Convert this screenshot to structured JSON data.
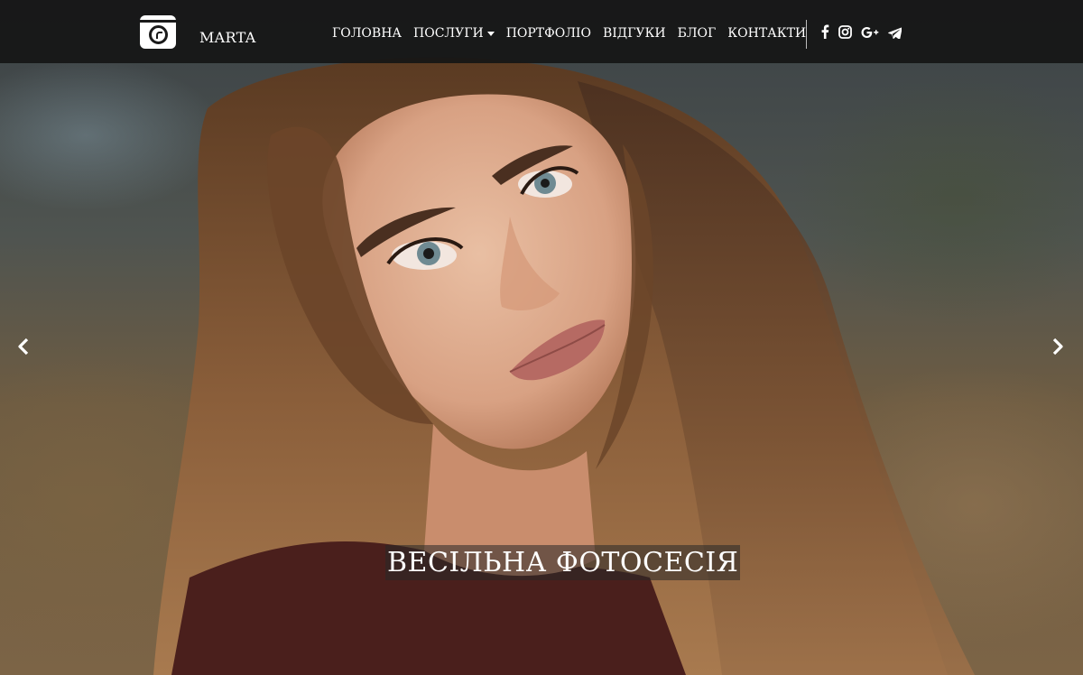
{
  "header": {
    "brand": "MARTA",
    "nav": [
      {
        "label": "ГОЛОВНА"
      },
      {
        "label": "ПОСЛУГИ"
      },
      {
        "label": "ПОРТФОЛІО"
      },
      {
        "label": "ВІДГУКИ"
      },
      {
        "label": "БЛОГ"
      },
      {
        "label": "КОНТАКТИ"
      }
    ],
    "social": [
      "facebook-icon",
      "instagram-icon",
      "google-plus-icon",
      "telegram-icon"
    ]
  },
  "carousel": {
    "caption": "ВЕСІЛЬНА ФОТОСЕСІЯ",
    "prev_icon": "chevron-left-icon",
    "next_icon": "chevron-right-icon"
  },
  "colors": {
    "navbar_bg": "#161616",
    "text": "#ffffff",
    "caption_bg": "#282828"
  }
}
